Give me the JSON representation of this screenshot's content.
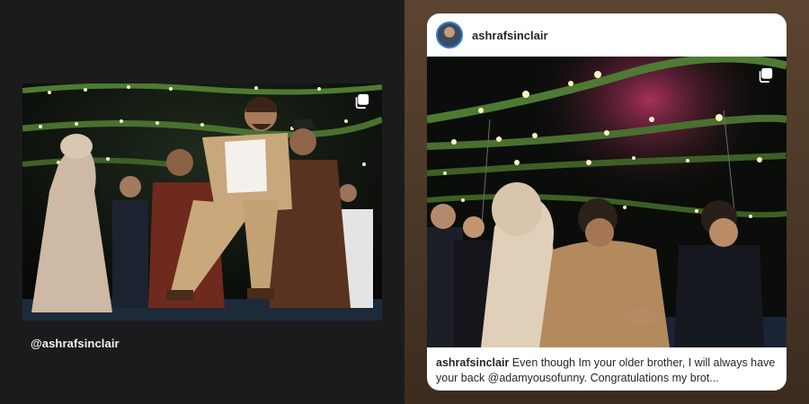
{
  "left_post": {
    "username": "@ashrafsinclair",
    "photo_icon": "multiple-photos-icon"
  },
  "right_post": {
    "username": "ashrafsinclair",
    "avatar_icon": "profile-avatar",
    "photo_icon": "multiple-photos-icon",
    "caption_username": "ashrafsinclair",
    "caption_text": "Even though Im your older brother, I will always have your back @adamyousofunny. Congratulations my brot..."
  },
  "colors": {
    "left_bg": "#1b1b1c",
    "right_bg": "#4a3726",
    "card_bg": "#ffffff",
    "text_dark": "#262626",
    "text_light": "#f2f2f2"
  }
}
